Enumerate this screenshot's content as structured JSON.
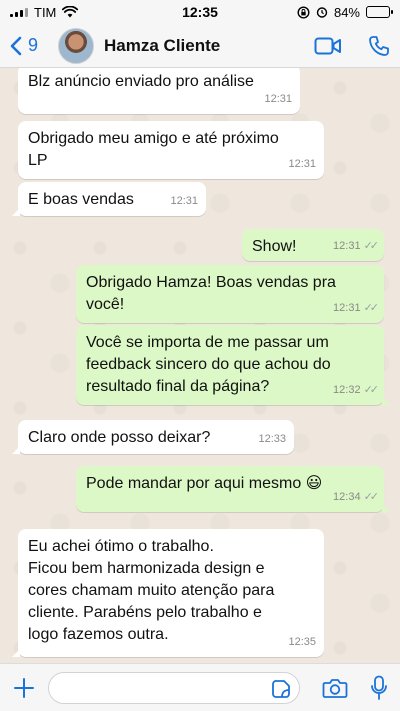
{
  "status_bar": {
    "carrier": "TIM",
    "time": "12:35",
    "battery": "84%",
    "battery_level": 0.84
  },
  "header": {
    "back_count": "9",
    "contact_name": "Hamza Cliente",
    "icons": [
      "chevron-left-icon",
      "video-call-icon",
      "phone-icon"
    ]
  },
  "messages": [
    {
      "direction": "in",
      "text": "Blz anúncio enviado pro análise",
      "time": "12:31"
    },
    {
      "direction": "in",
      "text": "Obrigado meu amigo e até próximo\nLP",
      "time": "12:31"
    },
    {
      "direction": "in",
      "text": "E boas vendas",
      "time": "12:31"
    },
    {
      "direction": "out",
      "text": "Show!",
      "time": "12:31",
      "status": "read"
    },
    {
      "direction": "out",
      "text": "Obrigado Hamza! Boas vendas pra\nvocê!",
      "time": "12:31",
      "status": "read"
    },
    {
      "direction": "out",
      "text": "Você se importa de me passar um\nfeedback sincero do que achou do\nresultado final da página?",
      "time": "12:32",
      "status": "read"
    },
    {
      "direction": "in",
      "text": "Claro onde posso deixar?",
      "time": "12:33"
    },
    {
      "direction": "out",
      "text": "Pode mandar por aqui mesmo 😃",
      "time": "12:34",
      "status": "read"
    },
    {
      "direction": "in",
      "text": "Eu achei ótimo o trabalho.\nFicou bem harmonizada design e\ncores chamam muito atenção para\ncliente. Parabéns pelo trabalho e\nlogo fazemos outra.",
      "time": "12:35"
    }
  ],
  "input_bar": {
    "placeholder": "",
    "icons": [
      "plus-icon",
      "sticker-icon",
      "camera-icon",
      "microphone-icon"
    ]
  },
  "colors": {
    "accent": "#1a73d9",
    "incoming_bubble": "#ffffff",
    "outgoing_bubble": "#dcf8c6",
    "chat_background": "#efe7de"
  }
}
